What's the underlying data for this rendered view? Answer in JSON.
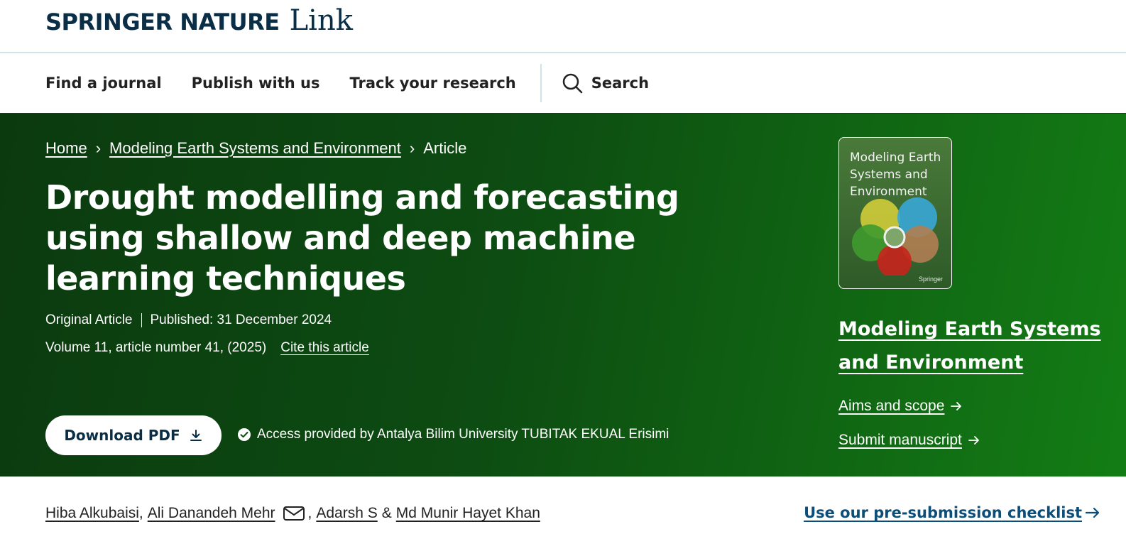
{
  "header": {
    "logo_brand": "SPRINGER NATURE",
    "logo_link": "Link"
  },
  "nav": {
    "items": [
      "Find a journal",
      "Publish with us",
      "Track your research"
    ],
    "search_label": "Search"
  },
  "breadcrumb": {
    "home": "Home",
    "journal": "Modeling Earth Systems and Environment",
    "current": "Article"
  },
  "article": {
    "title": "Drought modelling and forecasting using shallow and deep machine learning techniques",
    "type": "Original Article",
    "published": "Published: 31 December 2024",
    "volume": "Volume 11, article number 41, (2025)",
    "cite_label": "Cite this article"
  },
  "actions": {
    "download_label": "Download PDF",
    "access_text": "Access provided by Antalya Bilim University TUBITAK EKUAL Erisimi"
  },
  "journal": {
    "cover_title": "Modeling Earth Systems and Environment",
    "cover_publisher": "Springer",
    "link_label": "Modeling Earth Systems and Environment",
    "aims_label": "Aims and scope",
    "submit_label": "Submit manuscript"
  },
  "authors": {
    "names": [
      "Hiba Alkubaisi",
      "Ali Danandeh Mehr",
      "Adarsh S",
      "Md Munir Hayet Khan"
    ],
    "sep_comma": ",",
    "sep_and": "&"
  },
  "checklist_label": "Use our pre-submission checklist",
  "colors": {
    "brand_navy": "#0b2e47",
    "hero_green_dark": "#0b3a0f",
    "hero_green_light": "#137d14",
    "link_blue": "#0b4e79"
  }
}
